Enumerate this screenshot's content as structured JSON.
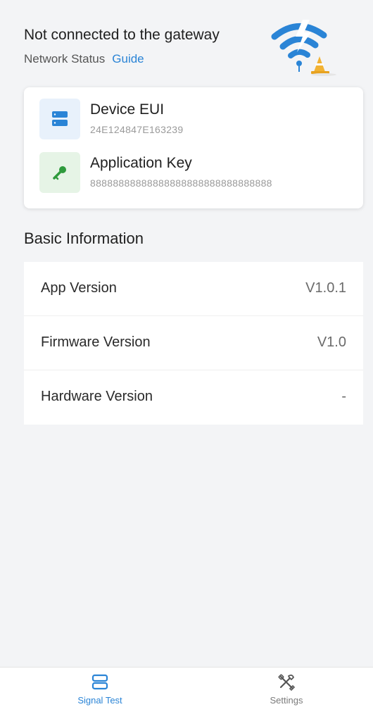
{
  "status": {
    "title": "Not connected to the gateway",
    "network_status_label": "Network Status",
    "guide_link": "Guide",
    "illustration_icon": "wifi-warning-icon"
  },
  "credentials": {
    "device_eui": {
      "label": "Device EUI",
      "value": "24E124847E163239",
      "icon": "server-icon"
    },
    "application_key": {
      "label": "Application Key",
      "value": "88888888888888888888888888888888",
      "icon": "key-icon"
    }
  },
  "basic_info": {
    "title": "Basic Information",
    "rows": [
      {
        "label": "App Version",
        "value": "V1.0.1"
      },
      {
        "label": "Firmware Version",
        "value": "V1.0"
      },
      {
        "label": "Hardware Version",
        "value": "-"
      }
    ]
  },
  "nav": {
    "items": [
      {
        "label": "Signal Test",
        "icon": "server-icon",
        "active": true
      },
      {
        "label": "Settings",
        "icon": "tools-icon",
        "active": false
      }
    ]
  },
  "colors": {
    "accent": "#2a84d6",
    "key_green": "#2e9a3c",
    "background": "#f3f4f6"
  }
}
